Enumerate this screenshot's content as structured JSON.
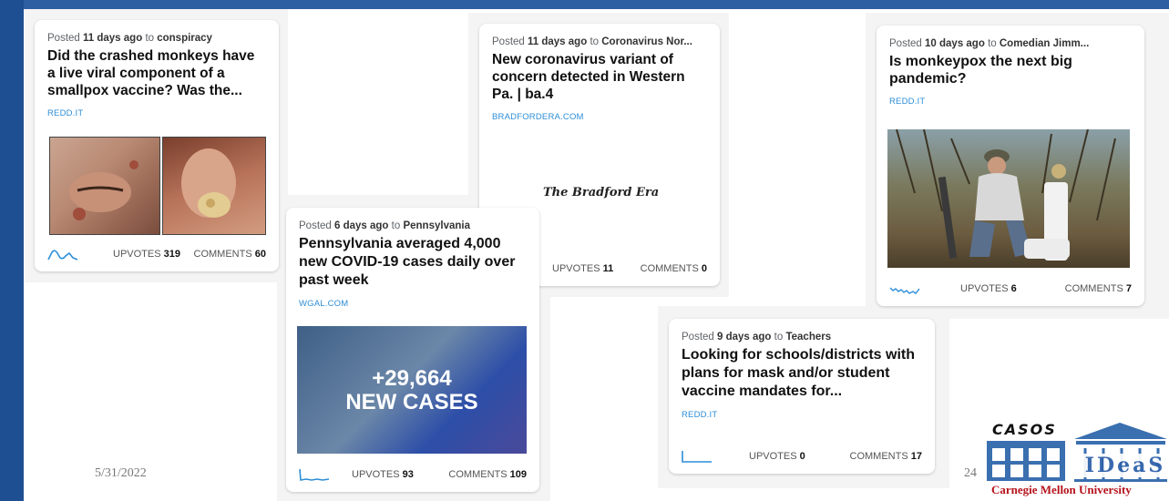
{
  "cards": {
    "c1": {
      "posted_prefix": "Posted",
      "age": "11 days ago",
      "to_word": "to",
      "community": "conspiracy",
      "title": "Did the crashed monkeys have a live viral component of a smallpox vaccine? Was the...",
      "domain": "REDD.IT",
      "upvotes_label": "UPVOTES",
      "upvotes": "319",
      "comments_label": "COMMENTS",
      "comments": "60"
    },
    "c2": {
      "posted_prefix": "Posted",
      "age": "11 days ago",
      "to_word": "to",
      "community": "Coronavirus Nor...",
      "title": "New coronavirus variant of concern detected in Western Pa. | ba.4",
      "domain": "BRADFORDERA.COM",
      "masthead": "The Bradford Era",
      "upvotes_label": "UPVOTES",
      "upvotes": "11",
      "comments_label": "COMMENTS",
      "comments": "0"
    },
    "c3": {
      "posted_prefix": "Posted",
      "age": "10 days ago",
      "to_word": "to",
      "community": "Comedian Jimm...",
      "title": "Is monkeypox the next big pandemic?",
      "domain": "REDD.IT",
      "upvotes_label": "UPVOTES",
      "upvotes": "6",
      "comments_label": "COMMENTS",
      "comments": "7"
    },
    "c4": {
      "posted_prefix": "Posted",
      "age": "6 days ago",
      "to_word": "to",
      "community": "Pennsylvania",
      "title": "Pennsylvania averaged 4,000 new COVID-19 cases daily over past week",
      "domain": "WGAL.COM",
      "overlay_number": "+29,664",
      "overlay_text": "NEW CASES",
      "upvotes_label": "UPVOTES",
      "upvotes": "93",
      "comments_label": "COMMENTS",
      "comments": "109"
    },
    "c5": {
      "posted_prefix": "Posted",
      "age": "9 days ago",
      "to_word": "to",
      "community": "Teachers",
      "title": "Looking for schools/districts with plans for mask and/or student vaccine mandates for...",
      "domain": "REDD.IT",
      "upvotes_label": "UPVOTES",
      "upvotes": "0",
      "comments_label": "COMMENTS",
      "comments": "17"
    }
  },
  "slide": {
    "date": "5/31/2022",
    "page_number": "24"
  },
  "logo": {
    "casos": "CASOS",
    "ideas": "IDeaS",
    "university": "Carnegie Mellon University"
  },
  "colors": {
    "frame": "#2f5fa3",
    "link": "#2c8ed8",
    "cmu_red": "#b5121b"
  }
}
